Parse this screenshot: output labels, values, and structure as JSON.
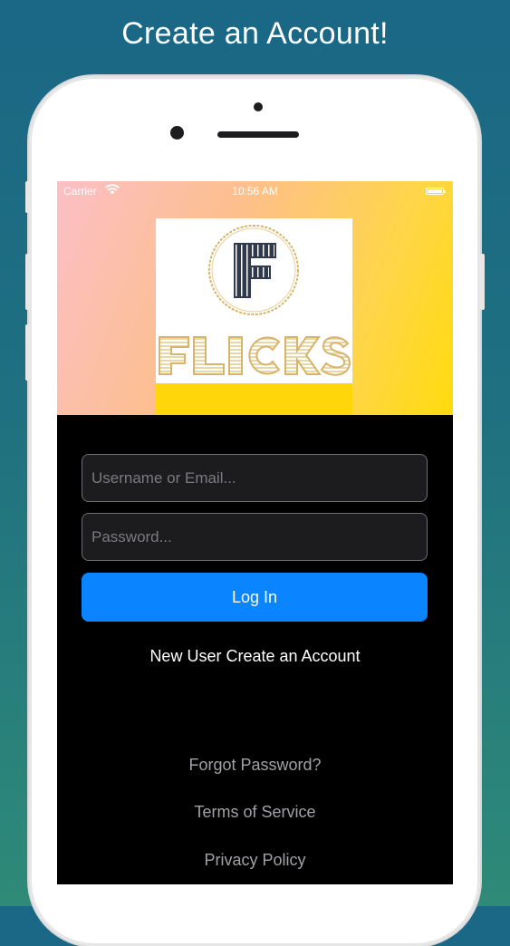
{
  "headline": "Create an Account!",
  "status_bar": {
    "carrier": "Carrier",
    "time": "10:56 AM",
    "wifi_icon": "wifi-icon",
    "battery_icon": "battery-icon"
  },
  "logo": {
    "text": "FLICKS",
    "monogram": "F",
    "colors": {
      "gold": "#d8b36a",
      "navy": "#2f3a4f",
      "strip": "#ffd60a"
    }
  },
  "form": {
    "username_placeholder": "Username or Email...",
    "password_placeholder": "Password...",
    "login_label": "Log In",
    "create_account_label": "New User Create an Account"
  },
  "footer_links": {
    "forgot_password": "Forgot Password?",
    "terms": "Terms of Service",
    "privacy": "Privacy Policy"
  },
  "colors": {
    "accent": "#0a84ff",
    "hero_gradient_start": "#fbbfc6",
    "hero_gradient_end": "#ffdb0d",
    "background_top": "#1a6786",
    "background_bottom": "#2f8a78"
  }
}
